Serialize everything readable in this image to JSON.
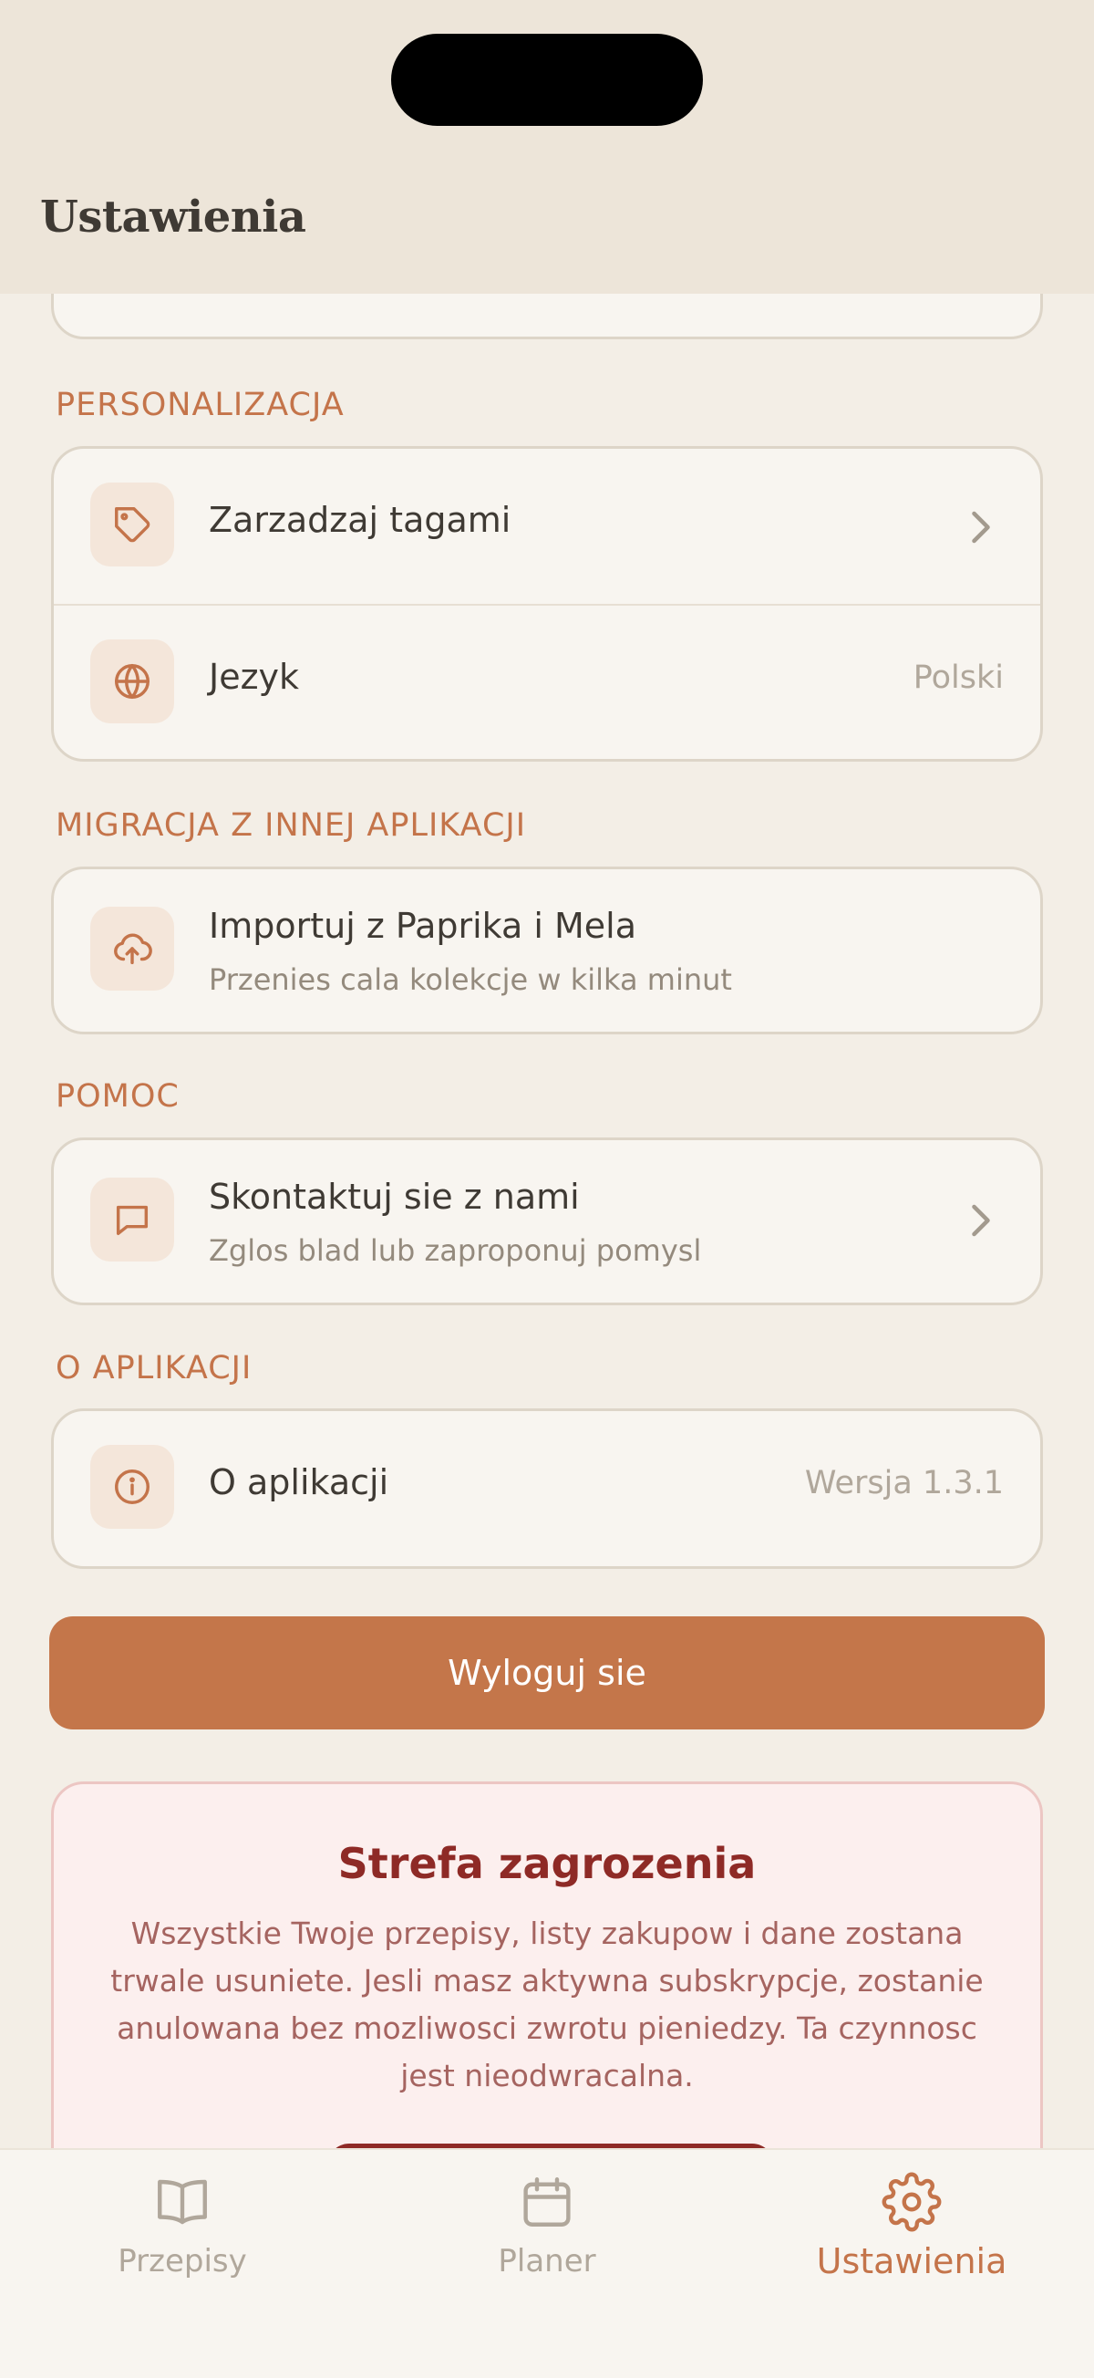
{
  "header": {
    "title": "Ustawienia"
  },
  "sections": {
    "personalization": {
      "label": "PERSONALIZACJA",
      "items": [
        {
          "title": "Zarzadzaj tagami",
          "icon": "tag-icon"
        },
        {
          "title": "Jezyk",
          "value": "Polski",
          "icon": "globe-icon"
        }
      ]
    },
    "migration": {
      "label": "MIGRACJA Z INNEJ APLIKACJI",
      "items": [
        {
          "title": "Importuj z Paprika i Mela",
          "subtitle": "Przenies cala kolekcje w kilka minut",
          "icon": "cloud-upload-icon"
        }
      ]
    },
    "help": {
      "label": "POMOC",
      "items": [
        {
          "title": "Skontaktuj sie z nami",
          "subtitle": "Zglos blad lub zaproponuj pomysl",
          "icon": "chat-icon"
        }
      ]
    },
    "about": {
      "label": "O APLIKACJI",
      "items": [
        {
          "title": "O aplikacji",
          "value": "Wersja 1.3.1",
          "icon": "info-icon"
        }
      ]
    }
  },
  "logout": {
    "label": "Wyloguj sie"
  },
  "danger_zone": {
    "title": "Strefa zagrozenia",
    "text": "Wszystkie Twoje przepisy, listy zakupow i dane zostana trwale usuniete. Jesli masz aktywna subskrypcje, zostanie anulowana bez mozliwosci zwrotu pieniedzy. Ta czynnosc jest nieodwracalna."
  },
  "tabbar": {
    "tabs": [
      {
        "label": "Przepisy",
        "icon": "book-icon",
        "active": false
      },
      {
        "label": "Planer",
        "icon": "calendar-icon",
        "active": false
      },
      {
        "label": "Ustawienia",
        "icon": "gear-icon",
        "active": true
      }
    ]
  },
  "colors": {
    "accent": "#c4744a",
    "danger": "#8e2a26",
    "background": "#f3eee6"
  }
}
